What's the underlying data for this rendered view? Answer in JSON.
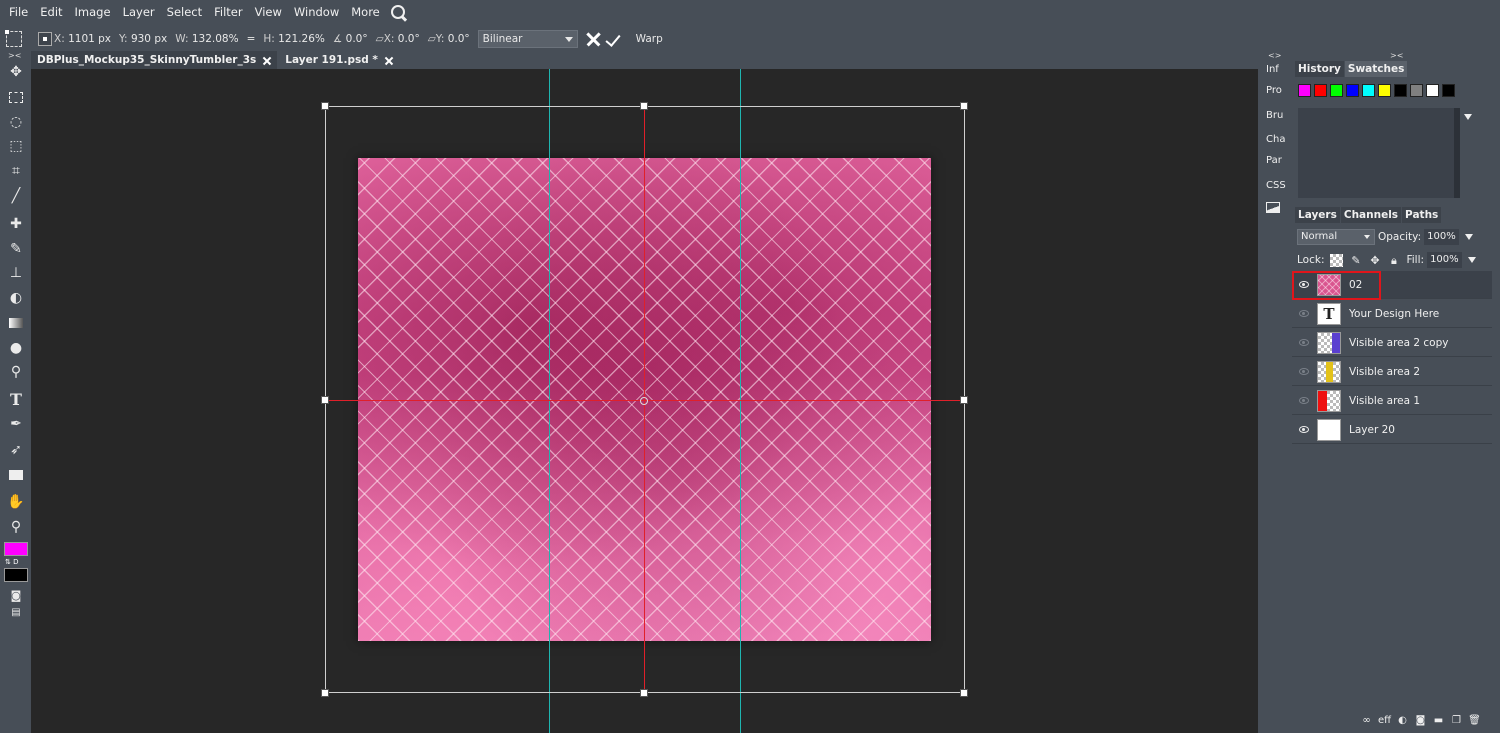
{
  "menu": [
    "File",
    "Edit",
    "Image",
    "Layer",
    "Select",
    "Filter",
    "View",
    "Window",
    "More"
  ],
  "options": {
    "x_label": "X:",
    "x_value": "1101 px",
    "y_label": "Y:",
    "y_value": "930 px",
    "w_label": "W:",
    "w_value": "132.08%",
    "h_label": "H:",
    "h_value": "121.26%",
    "angle_value": "0.0°",
    "skew_x_label": "X:",
    "skew_x_value": "0.0°",
    "skew_y_label": "Y:",
    "skew_y_value": "0.0°",
    "interpolation": "Bilinear",
    "warp_label": "Warp"
  },
  "tabs": [
    {
      "label": "DBPlus_Mockup35_SkinnyTumbler_3s",
      "active": false
    },
    {
      "label": "Layer 191.psd *",
      "active": true
    }
  ],
  "mini_panel": [
    "Inf",
    "Pro",
    "Bru",
    "Cha",
    "Par",
    "CSS"
  ],
  "history_tabs": [
    "History",
    "Swatches"
  ],
  "swatches": [
    "#ff00ff",
    "#ff0000",
    "#00ff00",
    "#0000ff",
    "#00ffff",
    "#ffff00",
    "#000000",
    "#808080",
    "#ffffff",
    "#000000"
  ],
  "layers_tabs": [
    "Layers",
    "Channels",
    "Paths"
  ],
  "blend_mode": "Normal",
  "opacity_label": "Opacity:",
  "opacity_value": "100%",
  "lock_label": "Lock:",
  "fill_label": "Fill:",
  "fill_value": "100%",
  "layers": [
    {
      "name": "02",
      "visible": true,
      "selected": true
    },
    {
      "name": "Your Design Here",
      "visible": false,
      "selected": false
    },
    {
      "name": "Visible area 2 copy",
      "visible": false,
      "selected": false
    },
    {
      "name": "Visible area 2",
      "visible": false,
      "selected": false
    },
    {
      "name": "Visible area 1",
      "visible": false,
      "selected": false
    },
    {
      "name": "Layer 20",
      "visible": true,
      "selected": false
    }
  ],
  "footer_eff": "eff",
  "colors": {
    "foreground": "#ff00ff",
    "background": "#000000",
    "guide": "#1fb5b0",
    "selection": "#e0151b"
  }
}
